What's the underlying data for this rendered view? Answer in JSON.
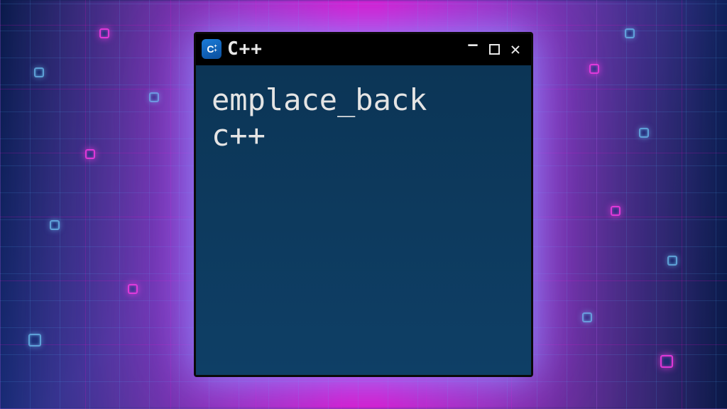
{
  "window": {
    "title": "C++",
    "icon_label": "C++",
    "icon_name": "cpp-hex-icon"
  },
  "controls": {
    "minimize": "–",
    "maximize": "",
    "close": "✕"
  },
  "body": {
    "line1": "emplace_back",
    "line2": "c++"
  },
  "colors": {
    "window_bg": "#0d3a5f",
    "titlebar_bg": "#000000",
    "text": "#e4e4e4",
    "glow": "#8a6cff"
  }
}
